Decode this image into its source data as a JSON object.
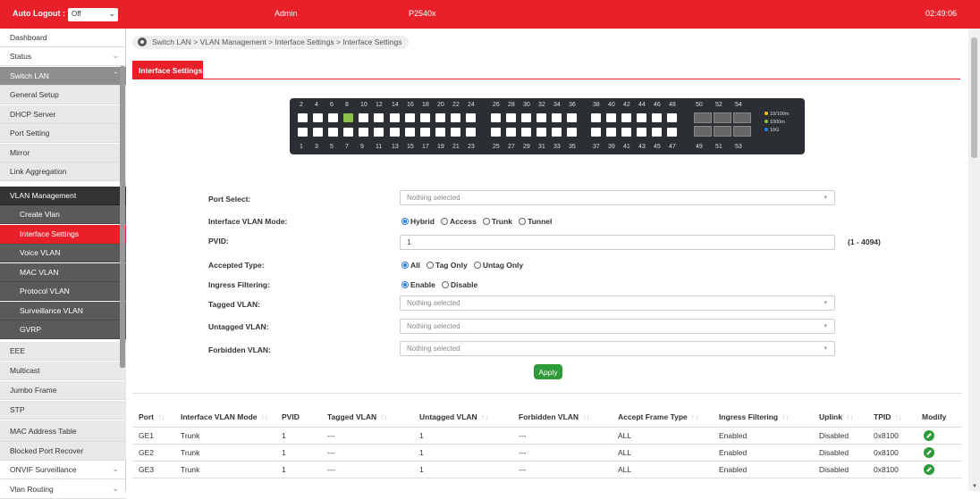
{
  "topbar": {
    "auto_logout_label": "Auto Logout :",
    "auto_logout_value": "Off",
    "user": "Admin",
    "model": "P2540x",
    "time": "02:49:06"
  },
  "sidebar": {
    "items": [
      {
        "label": "Dashboard"
      },
      {
        "label": "Status"
      },
      {
        "label": "Switch LAN"
      },
      {
        "label": "General Setup"
      },
      {
        "label": "DHCP Server"
      },
      {
        "label": "Port Setting"
      },
      {
        "label": "Mirror"
      },
      {
        "label": "Link Aggregation"
      },
      {
        "label": "VLAN Management"
      },
      {
        "label": "Create Vlan"
      },
      {
        "label": "Interface Settings"
      },
      {
        "label": "Voice VLAN"
      },
      {
        "label": "MAC VLAN"
      },
      {
        "label": "Protocol VLAN"
      },
      {
        "label": "Surveillance VLAN"
      },
      {
        "label": "GVRP"
      },
      {
        "label": "EEE"
      },
      {
        "label": "Multicast"
      },
      {
        "label": "Jumbo Frame"
      },
      {
        "label": "STP"
      },
      {
        "label": "MAC Address Table"
      },
      {
        "label": "Blocked Port Recover"
      },
      {
        "label": "ONVIF Surveillance"
      },
      {
        "label": "Vlan Routing"
      }
    ]
  },
  "breadcrumb": "Switch LAN > VLAN Management > Interface Settings > Interface Settings",
  "tab": "Interface Settings",
  "switch_panel": {
    "top_labels": [
      "2",
      "4",
      "6",
      "8",
      "10",
      "12",
      "14",
      "16",
      "18",
      "20",
      "22",
      "24",
      "26",
      "28",
      "30",
      "32",
      "34",
      "36",
      "38",
      "40",
      "42",
      "44",
      "46",
      "48",
      "50",
      "52",
      "54"
    ],
    "bottom_labels": [
      "1",
      "3",
      "5",
      "7",
      "9",
      "11",
      "13",
      "15",
      "17",
      "19",
      "21",
      "23",
      "25",
      "27",
      "29",
      "31",
      "33",
      "35",
      "37",
      "39",
      "41",
      "43",
      "45",
      "47",
      "49",
      "51",
      "53"
    ],
    "legend": [
      {
        "label": "10/100m",
        "color": "#f0c020"
      },
      {
        "label": "1000m",
        "color": "#8bc34a"
      },
      {
        "label": "10G",
        "color": "#2b7de9"
      }
    ],
    "active_ports": [
      "8"
    ]
  },
  "form": {
    "port_select": {
      "label": "Port Select:",
      "placeholder": "Nothing selected"
    },
    "mode": {
      "label": "Interface VLAN Mode:",
      "options": [
        "Hybrid",
        "Access",
        "Trunk",
        "Tunnel"
      ],
      "selected": "Hybrid"
    },
    "pvid": {
      "label": "PVID:",
      "value": "1",
      "range": "(1 - 4094)"
    },
    "accepted": {
      "label": "Accepted Type:",
      "options": [
        "All",
        "Tag Only",
        "Untag Only"
      ],
      "selected": "All"
    },
    "ingress": {
      "label": "Ingress Filtering:",
      "options": [
        "Enable",
        "Disable"
      ],
      "selected": "Enable"
    },
    "tagged": {
      "label": "Tagged VLAN:",
      "placeholder": "Nothing selected"
    },
    "untagged": {
      "label": "Untagged VLAN:",
      "placeholder": "Nothing selected"
    },
    "forbidden": {
      "label": "Forbidden VLAN:",
      "placeholder": "Nothing selected"
    },
    "apply": "Apply"
  },
  "table": {
    "columns": [
      "Port",
      "Interface VLAN Mode",
      "PVID",
      "Tagged VLAN",
      "Untagged VLAN",
      "Forbidden VLAN",
      "Accept Frame Type",
      "Ingress Filtering",
      "Uplink",
      "TPID",
      "Modify"
    ],
    "rows": [
      [
        "GE1",
        "Trunk",
        "1",
        "---",
        "1",
        "---",
        "ALL",
        "Enabled",
        "Disabled",
        "0x8100"
      ],
      [
        "GE2",
        "Trunk",
        "1",
        "---",
        "1",
        "---",
        "ALL",
        "Enabled",
        "Disabled",
        "0x8100"
      ],
      [
        "GE3",
        "Trunk",
        "1",
        "---",
        "1",
        "---",
        "ALL",
        "Enabled",
        "Disabled",
        "0x8100"
      ]
    ]
  }
}
